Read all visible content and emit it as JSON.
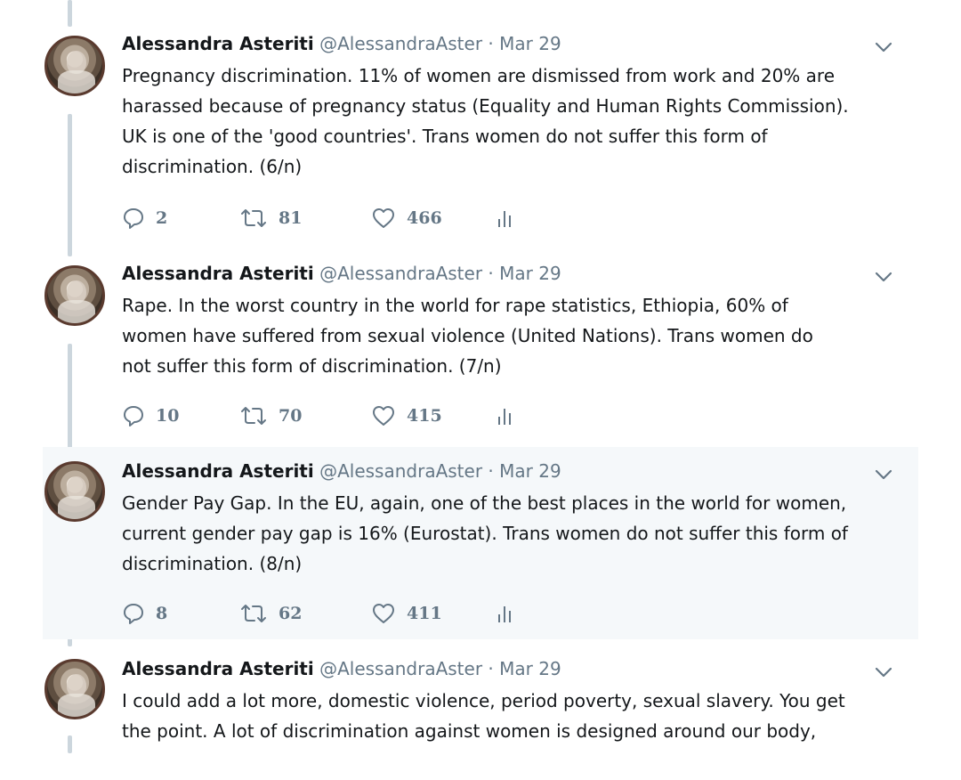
{
  "tweets": [
    {
      "name": "Alessandra Asteriti",
      "handle": "@AlessandraAster",
      "date": "Mar 29",
      "lines": [
        "Pregnancy discrimination. 11% of women are dismissed from work and 20% are",
        "harassed because of pregnancy status (Equality and Human Rights Commission).",
        "UK is one of the 'good countries'. Trans women do not suffer this form of",
        "discrimination. (6/n)"
      ],
      "replies": "2",
      "retweets": "81",
      "likes": "466"
    },
    {
      "name": "Alessandra Asteriti",
      "handle": "@AlessandraAster",
      "date": "Mar 29",
      "lines": [
        "Rape. In the worst country in the world for rape statistics, Ethiopia, 60% of",
        "women have suffered from sexual violence (United Nations). Trans women do",
        "not suffer this form of discrimination. (7/n)"
      ],
      "replies": "10",
      "retweets": "70",
      "likes": "415"
    },
    {
      "name": "Alessandra Asteriti",
      "handle": "@AlessandraAster",
      "date": "Mar 29",
      "lines": [
        "Gender Pay Gap. In the EU, again, one of the best places in the world for women,",
        "current gender pay gap is 16% (Eurostat). Trans women do not suffer this form of",
        "discrimination. (8/n)"
      ],
      "replies": "8",
      "retweets": "62",
      "likes": "411"
    },
    {
      "name": "Alessandra Asteriti",
      "handle": "@AlessandraAster",
      "date": "Mar 29",
      "lines": [
        "I could add a lot more, domestic violence, period poverty, sexual slavery. You get",
        "the point. A lot of discrimination against women is designed around our body,"
      ]
    }
  ],
  "separator": "·",
  "icons": {
    "reply": "reply-icon",
    "retweet": "retweet-icon",
    "like": "heart-icon",
    "analytics": "analytics-icon",
    "menu": "chevron-down-icon"
  },
  "colors": {
    "text": "#14171a",
    "muted": "#657786",
    "thread_line": "#ccd6dd",
    "highlight_bg": "#f5f8fa"
  }
}
